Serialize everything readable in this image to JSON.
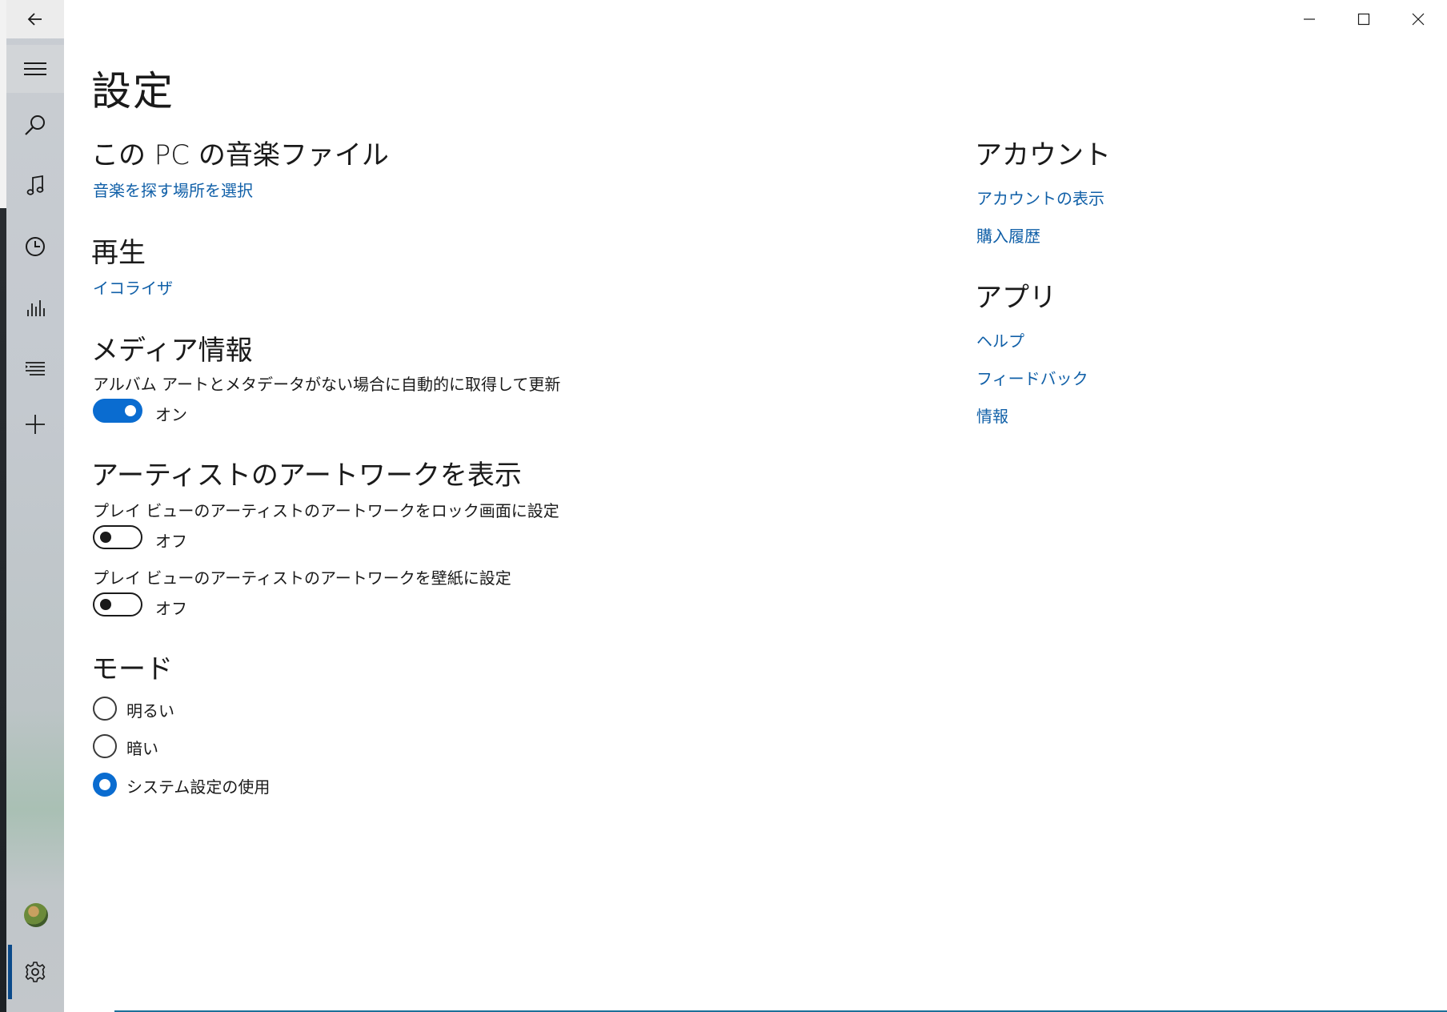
{
  "window": {
    "controls": [
      "minimize",
      "maximize",
      "close"
    ]
  },
  "nav": {
    "icons": [
      "back-arrow-icon",
      "hamburger-icon",
      "search-icon",
      "music-note-icon",
      "clock-icon",
      "chart-icon",
      "playlist-icon",
      "add-icon",
      "avatar",
      "gear-icon"
    ]
  },
  "page": {
    "title": "設定"
  },
  "music_files": {
    "title": "この PC の音楽ファイル",
    "link": "音楽を探す場所を選択"
  },
  "playback": {
    "title": "再生",
    "link": "イコライザ"
  },
  "media_info": {
    "title": "メディア情報",
    "description": "アルバム アートとメタデータがない場合に自動的に取得して更新",
    "toggle_state": "オン"
  },
  "artist_artwork": {
    "title": "アーティストのアートワークを表示",
    "lock_screen_label": "プレイ ビューのアーティストのアートワークをロック画面に設定",
    "lock_screen_state": "オフ",
    "wallpaper_label": "プレイ ビューのアーティストのアートワークを壁紙に設定",
    "wallpaper_state": "オフ"
  },
  "mode": {
    "title": "モード",
    "options": [
      "明るい",
      "暗い",
      "システム設定の使用"
    ],
    "selected": "システム設定の使用"
  },
  "account": {
    "title": "アカウント",
    "links": [
      "アカウントの表示",
      "購入履歴"
    ]
  },
  "app": {
    "title": "アプリ",
    "links": [
      "ヘルプ",
      "フィードバック",
      "情報"
    ]
  },
  "colors": {
    "accent": "#0a6cd0",
    "link": "#1160a8"
  }
}
